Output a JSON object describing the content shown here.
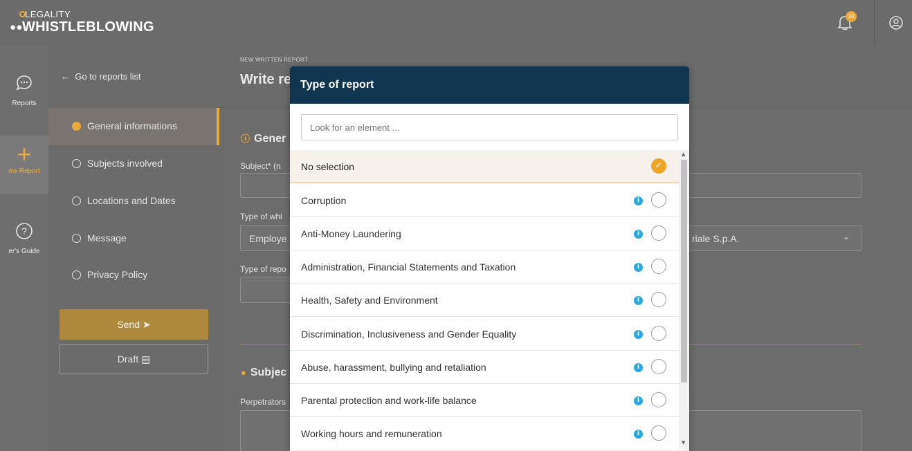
{
  "app": {
    "logo_line1": "LEGALITY",
    "logo_line2": "WHISTLEBLOWING",
    "notification_count": "10"
  },
  "rail": {
    "items": [
      {
        "label": "Reports",
        "icon": "chat-bubble-icon"
      },
      {
        "label": "New Report",
        "icon": "plus-icon",
        "visible_text": "ew Report"
      },
      {
        "label": "User's Guide",
        "icon": "question-circle-icon",
        "visible_text": "er's Guide"
      }
    ]
  },
  "sidebar": {
    "back_link": "Go to reports list",
    "steps": [
      {
        "label": "General informations",
        "active": true
      },
      {
        "label": "Subjects involved"
      },
      {
        "label": "Locations and Dates"
      },
      {
        "label": "Message"
      },
      {
        "label": "Privacy Policy"
      }
    ],
    "send_label": "Send",
    "draft_label": "Draft"
  },
  "main": {
    "breadcrumb": "NEW WRITTEN REPORT",
    "title": "Write re",
    "section_general": "Gener",
    "subject_label": "Subject* (n",
    "type_whistle_label": "Type of whi",
    "type_whistle_value": "Employe",
    "company_value": "riale S.p.A.",
    "type_report_label": "Type of repo",
    "section_subjects": "Subjec",
    "perpetrators_label": "Perpetrators"
  },
  "modal": {
    "title": "Type of report",
    "search_placeholder": "Look for an element ...",
    "options": [
      {
        "label": "No selection",
        "selected": true
      },
      {
        "label": "Corruption"
      },
      {
        "label": "Anti-Money Laundering"
      },
      {
        "label": "Administration, Financial Statements and Taxation"
      },
      {
        "label": "Health, Safety and Environment"
      },
      {
        "label": "Discrimination, Inclusiveness and Gender Equality"
      },
      {
        "label": "Abuse, harassment, bullying and retaliation"
      },
      {
        "label": "Parental protection and work-life balance"
      },
      {
        "label": "Working hours and remuneration"
      }
    ]
  },
  "colors": {
    "accent": "#e9a93a",
    "modal_header": "#0f3550",
    "info_icon": "#2aa9e0"
  }
}
